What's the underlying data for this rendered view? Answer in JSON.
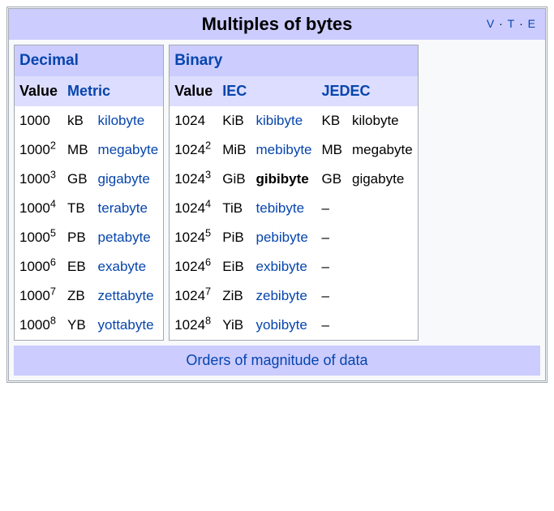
{
  "title": "Multiples of bytes",
  "vte": {
    "v": "V",
    "t": "T",
    "e": "E"
  },
  "decimal": {
    "header": "Decimal",
    "value_header": "Value",
    "metric_header": "Metric",
    "rows": [
      {
        "base": "1000",
        "exp": "",
        "sym": "kB",
        "name": "kilobyte"
      },
      {
        "base": "1000",
        "exp": "2",
        "sym": "MB",
        "name": "megabyte"
      },
      {
        "base": "1000",
        "exp": "3",
        "sym": "GB",
        "name": "gigabyte"
      },
      {
        "base": "1000",
        "exp": "4",
        "sym": "TB",
        "name": "terabyte"
      },
      {
        "base": "1000",
        "exp": "5",
        "sym": "PB",
        "name": "petabyte"
      },
      {
        "base": "1000",
        "exp": "6",
        "sym": "EB",
        "name": "exabyte"
      },
      {
        "base": "1000",
        "exp": "7",
        "sym": "ZB",
        "name": "zettabyte"
      },
      {
        "base": "1000",
        "exp": "8",
        "sym": "YB",
        "name": "yottabyte"
      }
    ]
  },
  "binary": {
    "header": "Binary",
    "value_header": "Value",
    "iec_header": "IEC",
    "jedec_header": "JEDEC",
    "rows": [
      {
        "base": "1024",
        "exp": "",
        "iec_sym": "KiB",
        "iec_name": "kibibyte",
        "iec_bold": false,
        "jedec_sym": "KB",
        "jedec_name": "kilobyte"
      },
      {
        "base": "1024",
        "exp": "2",
        "iec_sym": "MiB",
        "iec_name": "mebibyte",
        "iec_bold": false,
        "jedec_sym": "MB",
        "jedec_name": "megabyte"
      },
      {
        "base": "1024",
        "exp": "3",
        "iec_sym": "GiB",
        "iec_name": "gibibyte",
        "iec_bold": true,
        "jedec_sym": "GB",
        "jedec_name": "gigabyte"
      },
      {
        "base": "1024",
        "exp": "4",
        "iec_sym": "TiB",
        "iec_name": "tebibyte",
        "iec_bold": false,
        "jedec_sym": "",
        "jedec_name": "–"
      },
      {
        "base": "1024",
        "exp": "5",
        "iec_sym": "PiB",
        "iec_name": "pebibyte",
        "iec_bold": false,
        "jedec_sym": "",
        "jedec_name": "–"
      },
      {
        "base": "1024",
        "exp": "6",
        "iec_sym": "EiB",
        "iec_name": "exbibyte",
        "iec_bold": false,
        "jedec_sym": "",
        "jedec_name": "–"
      },
      {
        "base": "1024",
        "exp": "7",
        "iec_sym": "ZiB",
        "iec_name": "zebibyte",
        "iec_bold": false,
        "jedec_sym": "",
        "jedec_name": "–"
      },
      {
        "base": "1024",
        "exp": "8",
        "iec_sym": "YiB",
        "iec_name": "yobibyte",
        "iec_bold": false,
        "jedec_sym": "",
        "jedec_name": "–"
      }
    ]
  },
  "footer": "Orders of magnitude of data"
}
